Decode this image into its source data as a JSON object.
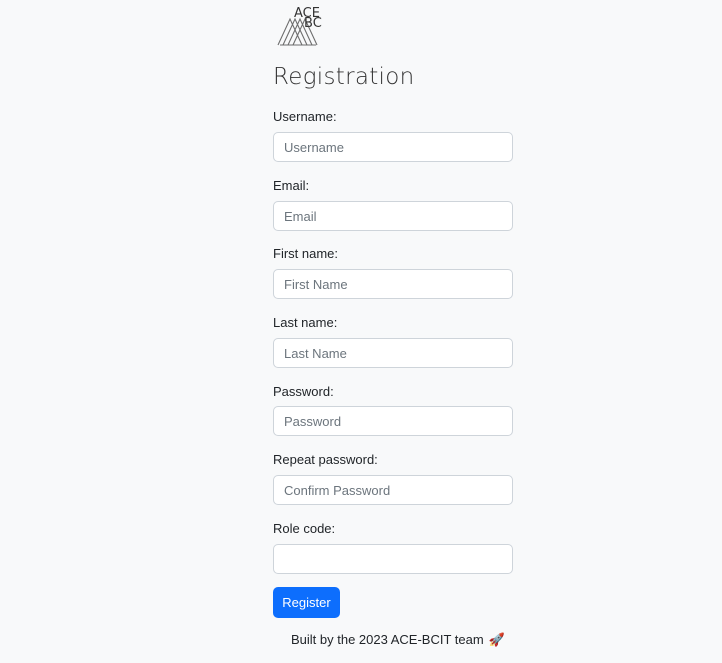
{
  "logo": {
    "line1": "ACE",
    "line2": "BC",
    "icon": "ace-bcit-logo-icon"
  },
  "page_title": "Registration",
  "form": {
    "fields": [
      {
        "label": "Username:",
        "placeholder": "Username",
        "value": ""
      },
      {
        "label": "Email:",
        "placeholder": "Email",
        "value": ""
      },
      {
        "label": "First name:",
        "placeholder": "First Name",
        "value": ""
      },
      {
        "label": "Last name:",
        "placeholder": "Last Name",
        "value": ""
      },
      {
        "label": "Password:",
        "placeholder": "Password",
        "value": ""
      },
      {
        "label": "Repeat password:",
        "placeholder": "Confirm Password",
        "value": ""
      },
      {
        "label": "Role code:",
        "placeholder": "",
        "value": ""
      }
    ],
    "submit_label": "Register"
  },
  "footer": {
    "text": "Built by the 2023 ACE-BCIT team",
    "emoji": "🚀",
    "emoji_icon": "rocket-icon"
  },
  "colors": {
    "background": "#f8f9fa",
    "primary_button": "#0d6efd",
    "input_border": "#ced4da"
  }
}
